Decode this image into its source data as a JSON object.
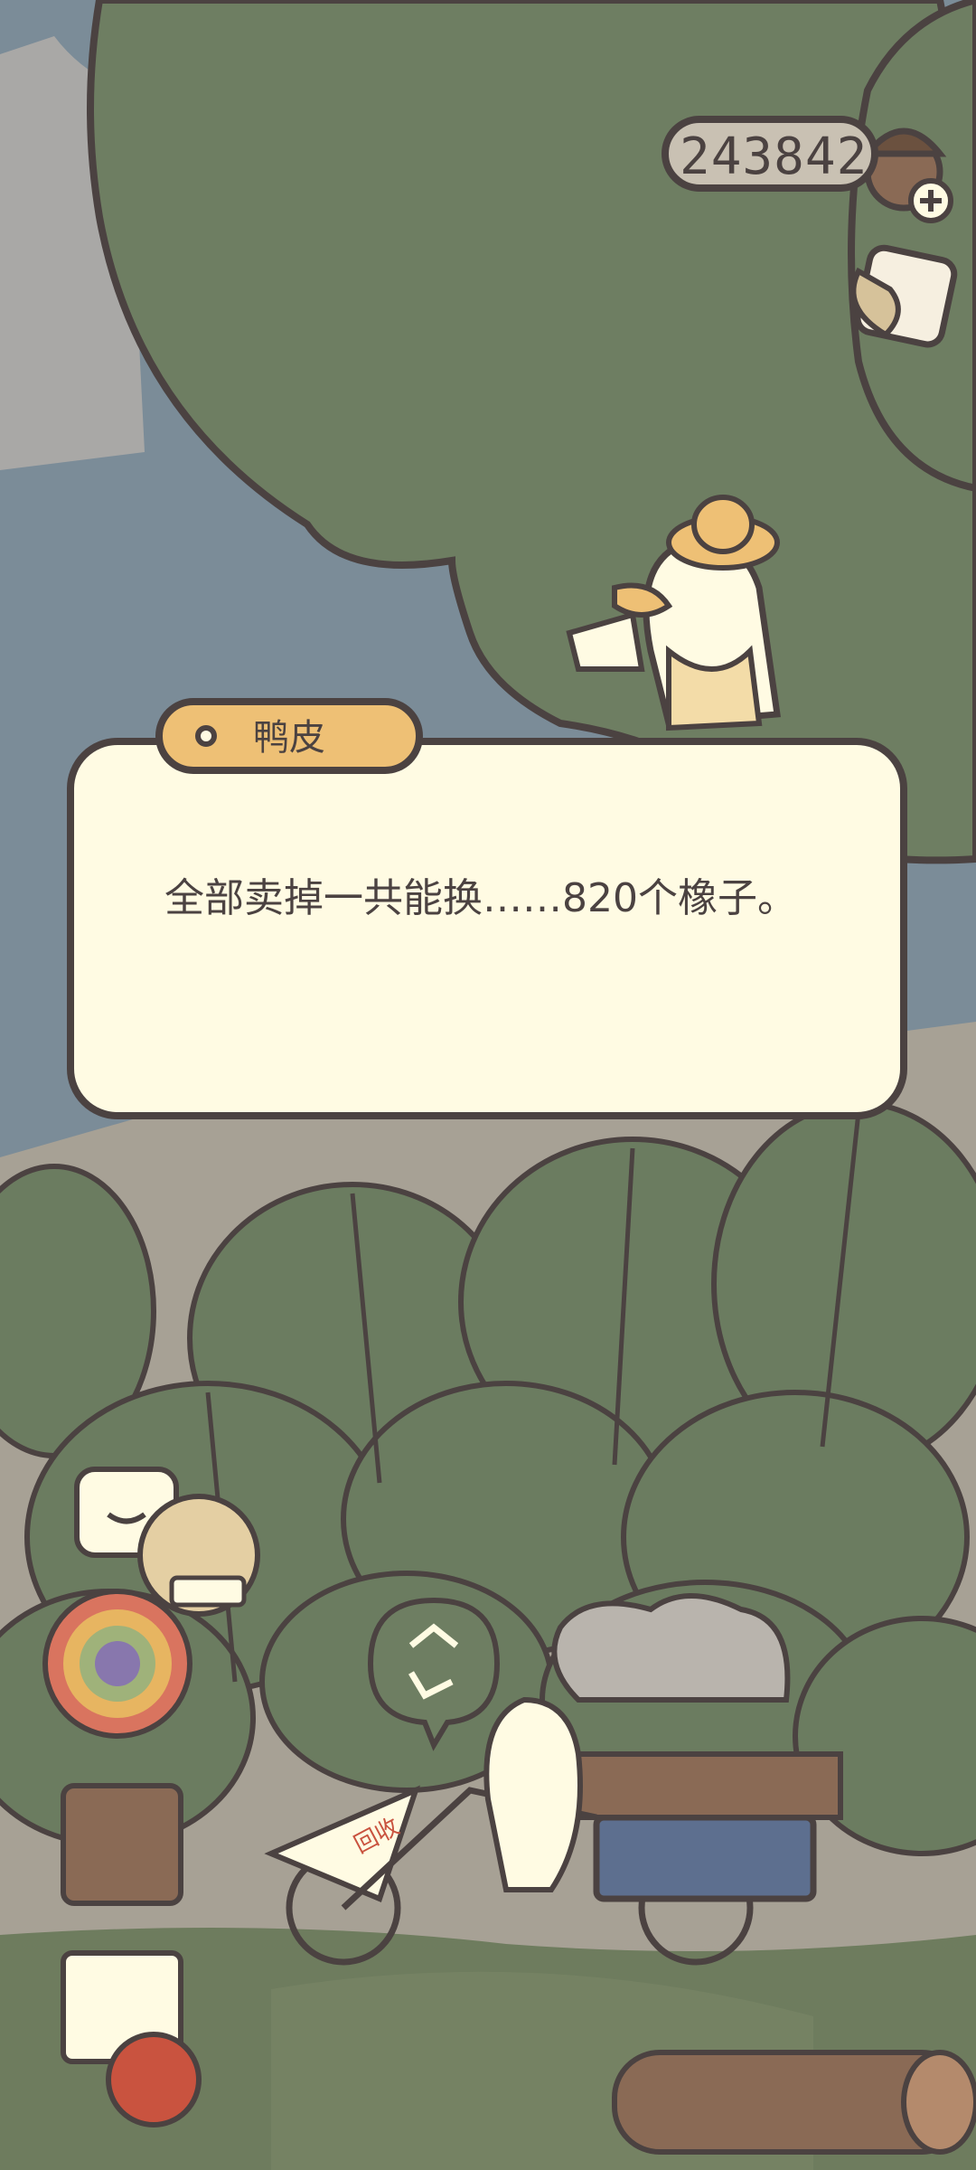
{
  "hud": {
    "acorn_count": "243842",
    "add_acorns_icon": "plus-icon",
    "acorn_icon": "acorn-icon",
    "phone_icon": "phone-icon"
  },
  "dialog": {
    "speaker": "鸭皮",
    "text": "全部卖掉一共能换……820个橡子。"
  },
  "shop": {
    "recycle_icon": "recycle-icon",
    "sign_text": "回收"
  }
}
